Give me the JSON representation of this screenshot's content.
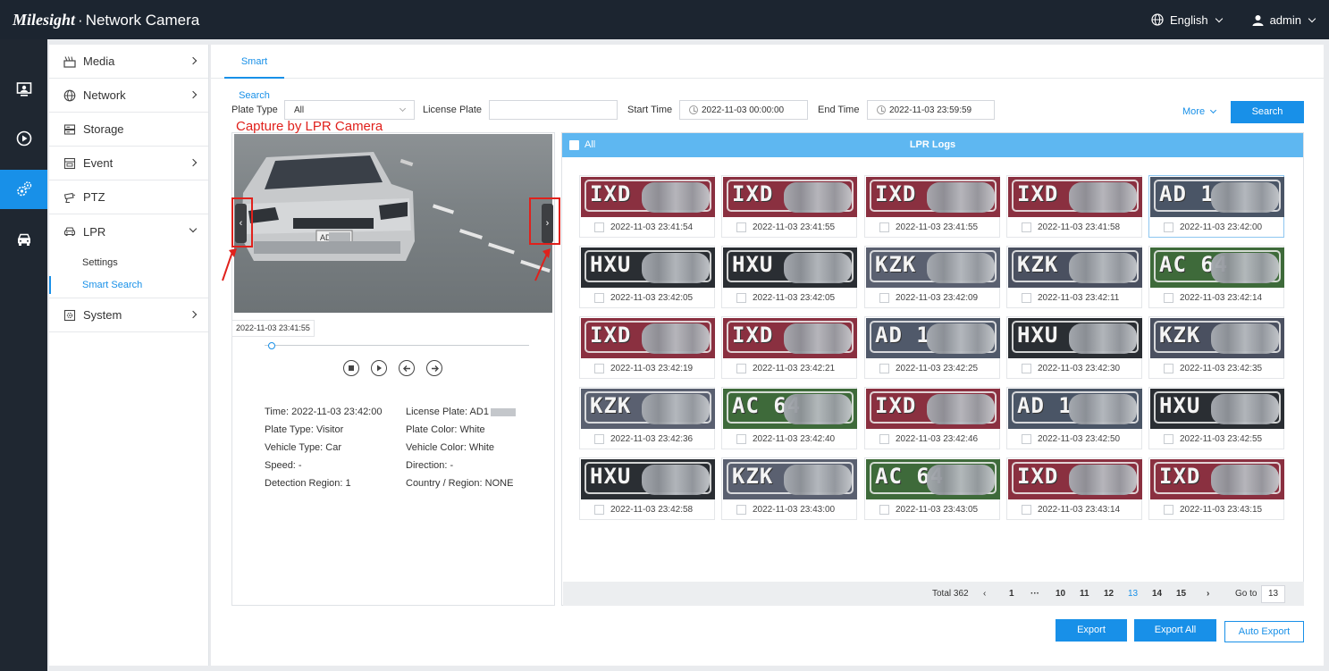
{
  "header": {
    "brand_logo": "Milesight",
    "brand_sep": "·",
    "brand_product": "Network Camera",
    "language": "English",
    "user": "admin"
  },
  "rail": [
    "live-view-icon",
    "playback-icon",
    "settings-icon",
    "vehicle-icon"
  ],
  "sidemenu": {
    "items": [
      {
        "label": "Media",
        "icon": "media-icon",
        "arrow": "right"
      },
      {
        "label": "Network",
        "icon": "globe-icon",
        "arrow": "right"
      },
      {
        "label": "Storage",
        "icon": "storage-icon",
        "arrow": ""
      },
      {
        "label": "Event",
        "icon": "event-icon",
        "arrow": "right"
      },
      {
        "label": "PTZ",
        "icon": "ptz-icon",
        "arrow": ""
      },
      {
        "label": "LPR",
        "icon": "car-icon",
        "arrow": "down"
      },
      {
        "label": "System",
        "icon": "system-icon",
        "arrow": "right"
      }
    ],
    "lpr_sub": [
      {
        "label": "Settings",
        "active": false
      },
      {
        "label": "Smart Search",
        "active": true
      }
    ]
  },
  "tabs": {
    "active": "Smart Search"
  },
  "search": {
    "plate_type_label": "Plate Type",
    "plate_type_value": "All",
    "license_plate_label": "License Plate",
    "license_plate_value": "",
    "start_time_label": "Start Time",
    "start_time_value": "2022-11-03 00:00:00",
    "end_time_label": "End Time",
    "end_time_value": "2022-11-03 23:59:59",
    "more_label": "More",
    "search_button": "Search"
  },
  "preview": {
    "annotation": "Capture by LPR Camera",
    "prev_glyph": "‹",
    "next_glyph": "›",
    "timestamp": "2022-11-03 23:41:55",
    "playback_progress": 0.02,
    "plate_on_car": "AD1",
    "details": {
      "time": "Time: 2022-11-03 23:42:00",
      "license_plate": "License Plate: AD1",
      "plate_type": "Plate Type: Visitor",
      "plate_color": "Plate Color: White",
      "vehicle_type": "Vehicle Type: Car",
      "vehicle_color": "Vehicle Color: White",
      "speed": "Speed: -",
      "direction": "Direction: -",
      "detection_region": "Detection Region: 1",
      "country_region": "Country / Region: NONE"
    }
  },
  "logs": {
    "all_label": "All",
    "title": "LPR Logs",
    "cards": [
      {
        "plate": "IXD",
        "time": "2022-11-03 23:41:54",
        "bg": "#8a3040"
      },
      {
        "plate": "IXD",
        "time": "2022-11-03 23:41:55",
        "bg": "#8a3040"
      },
      {
        "plate": "IXD",
        "time": "2022-11-03 23:41:55",
        "bg": "#8a3040"
      },
      {
        "plate": "IXD",
        "time": "2022-11-03 23:41:58",
        "bg": "#8a3040"
      },
      {
        "plate": "AD 1",
        "time": "2022-11-03 23:42:00",
        "bg": "#4a5566",
        "selected": true
      },
      {
        "plate": "HXU",
        "time": "2022-11-03 23:42:05",
        "bg": "#2a2e33"
      },
      {
        "plate": "HXU",
        "time": "2022-11-03 23:42:05",
        "bg": "#2a2e33"
      },
      {
        "plate": "KZK",
        "time": "2022-11-03 23:42:09",
        "bg": "#5a6070"
      },
      {
        "plate": "KZK",
        "time": "2022-11-03 23:42:11",
        "bg": "#4a5060"
      },
      {
        "plate": "AC 64",
        "time": "2022-11-03 23:42:14",
        "bg": "#3e6a3a"
      },
      {
        "plate": "IXD",
        "time": "2022-11-03 23:42:19",
        "bg": "#8a3040"
      },
      {
        "plate": "IXD",
        "time": "2022-11-03 23:42:21",
        "bg": "#8a3040"
      },
      {
        "plate": "AD 1",
        "time": "2022-11-03 23:42:25",
        "bg": "#50596a"
      },
      {
        "plate": "HXU",
        "time": "2022-11-03 23:42:30",
        "bg": "#2a2e33"
      },
      {
        "plate": "KZK",
        "time": "2022-11-03 23:42:35",
        "bg": "#4a5060"
      },
      {
        "plate": "KZK",
        "time": "2022-11-03 23:42:36",
        "bg": "#5a6070"
      },
      {
        "plate": "AC 64",
        "time": "2022-11-03 23:42:40",
        "bg": "#3e6a3a"
      },
      {
        "plate": "IXD",
        "time": "2022-11-03 23:42:46",
        "bg": "#8a3040"
      },
      {
        "plate": "AD 1",
        "time": "2022-11-03 23:42:50",
        "bg": "#4a5566"
      },
      {
        "plate": "HXU",
        "time": "2022-11-03 23:42:55",
        "bg": "#2a2e33"
      },
      {
        "plate": "HXU",
        "time": "2022-11-03 23:42:58",
        "bg": "#2a2e33"
      },
      {
        "plate": "KZK",
        "time": "2022-11-03 23:43:00",
        "bg": "#5a6070"
      },
      {
        "plate": "AC 64",
        "time": "2022-11-03 23:43:05",
        "bg": "#3e6a3a"
      },
      {
        "plate": "IXD",
        "time": "2022-11-03 23:43:14",
        "bg": "#8a3040"
      },
      {
        "plate": "IXD",
        "time": "2022-11-03 23:43:15",
        "bg": "#8a3040"
      }
    ],
    "pager": {
      "total": "Total 362",
      "prev": "‹",
      "pages": [
        "1",
        "···",
        "10",
        "11",
        "12",
        "13",
        "14",
        "15"
      ],
      "current": "13",
      "next": "›",
      "goto_label": "Go to",
      "goto_value": "13"
    }
  },
  "actions": {
    "export": "Export",
    "export_all": "Export All",
    "auto_export": "Auto Export"
  },
  "colors": {
    "accent": "#1890e8",
    "header_bg": "#1c2530",
    "logs_header": "#5eb7f1",
    "annotation": "#e0211c"
  }
}
